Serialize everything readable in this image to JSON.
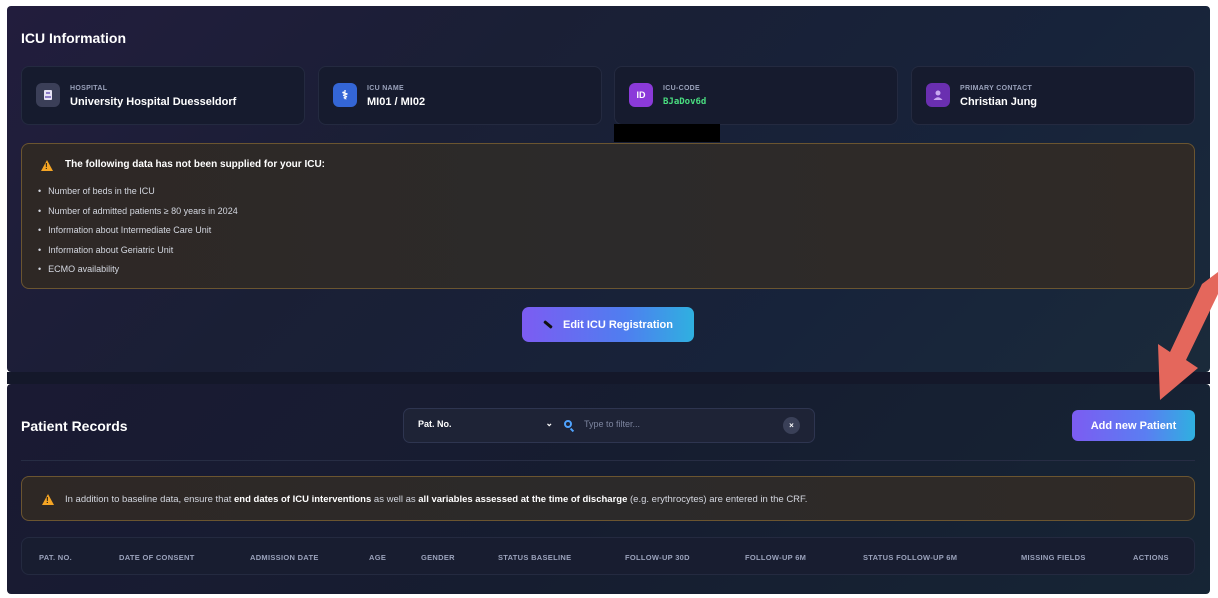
{
  "icu_info": {
    "title": "ICU Information",
    "cards": [
      {
        "label": "HOSPITAL",
        "value": "University Hospital Duesseldorf",
        "icon": "hospital-icon",
        "color": "#3b3f58"
      },
      {
        "label": "ICU NAME",
        "value": "MI01 / MI02",
        "icon": "medical-icon",
        "color": "#3466d6"
      },
      {
        "label": "ICU-CODE",
        "value": "BJaDov6d",
        "icon": "id-icon",
        "color": "#8b3ad9"
      },
      {
        "label": "PRIMARY CONTACT",
        "value": "Christian Jung",
        "icon": "person-icon",
        "color": "#6a2fb0"
      }
    ]
  },
  "missing_data": {
    "title": "The following data has not been supplied for your ICU:",
    "items": [
      "Number of beds in the ICU",
      "Number of admitted patients ≥ 80 years in 2024",
      "Information about Intermediate Care Unit",
      "Information about Geriatric Unit",
      "ECMO availability"
    ]
  },
  "edit_button_label": "Edit ICU Registration",
  "patient_records": {
    "title": "Patient Records",
    "filter_select_value": "Pat. No.",
    "filter_placeholder": "Type to filter...",
    "clear_label": "×",
    "add_button_label": "Add new Patient",
    "note": {
      "part1": "In addition to baseline data, ensure that ",
      "bold1": "end dates of ICU interventions",
      "part2": " as well as ",
      "bold2": "all variables assessed at the time of discharge",
      "part3": " (e.g. erythrocytes) are entered in the CRF."
    },
    "columns": [
      "PAT. NO.",
      "DATE OF CONSENT",
      "ADMISSION DATE",
      "AGE",
      "GENDER",
      "STATUS BASELINE",
      "FOLLOW-UP 30D",
      "FOLLOW-UP 6M",
      "STATUS FOLLOW-UP 6M",
      "MISSING FIELDS",
      "ACTIONS"
    ]
  },
  "colors": {
    "accent_gradient_start": "#7c5cf2",
    "accent_gradient_end": "#2fb0e0",
    "warning": "#f5a524",
    "code_green": "#4ade80",
    "arrow": "#e4675c"
  }
}
